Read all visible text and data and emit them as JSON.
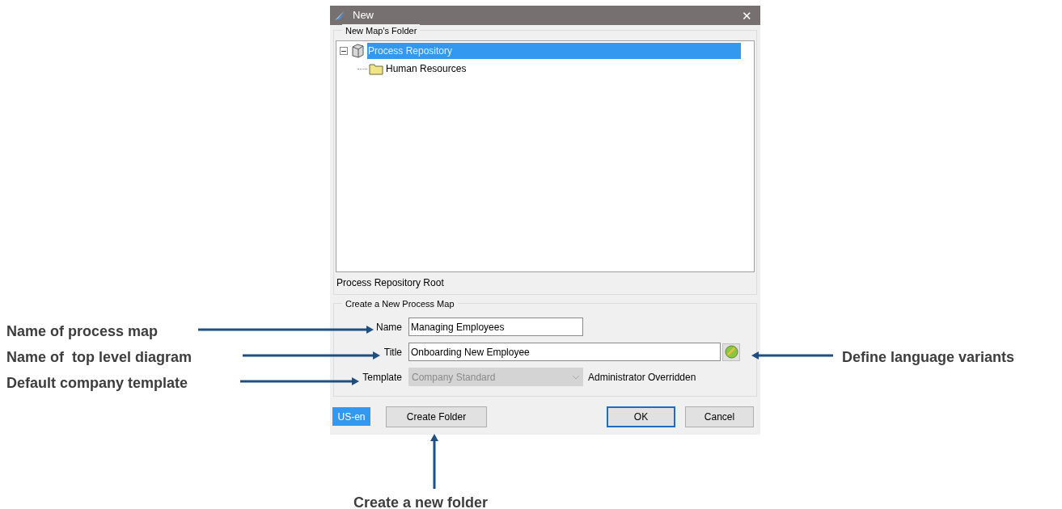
{
  "window": {
    "title": "New",
    "close": "✕"
  },
  "folder_group": {
    "label": "New Map's Folder",
    "tree": [
      {
        "label": "Process Repository",
        "kind": "repository",
        "selected": true,
        "expanded": true,
        "children": [
          {
            "label": "Human Resources",
            "kind": "folder",
            "selected": false
          }
        ]
      }
    ],
    "path": "Process Repository Root"
  },
  "map_group": {
    "label": "Create a New Process Map",
    "fields": [
      {
        "kind": "text",
        "label": "Name",
        "value": "Managing Employees",
        "disabled": false
      },
      {
        "kind": "text_language",
        "label": "Title",
        "value": "Onboarding New Employee",
        "disabled": false
      },
      {
        "kind": "select",
        "label": "Template",
        "value": "Company Standard",
        "disabled": true,
        "note": "Administrator Overridden"
      }
    ]
  },
  "buttons": [
    {
      "kind": "locale",
      "label": "US-en",
      "focused": false
    },
    {
      "kind": "normal",
      "label": "Create Folder",
      "focused": false
    },
    {
      "kind": "normal",
      "label": "OK",
      "focused": true
    },
    {
      "kind": "normal",
      "label": "Cancel",
      "focused": false
    }
  ],
  "annotations": [
    "Name of process map",
    "Name of  top level diagram",
    "Default company template",
    "Define language variants",
    "Create a new folder"
  ]
}
